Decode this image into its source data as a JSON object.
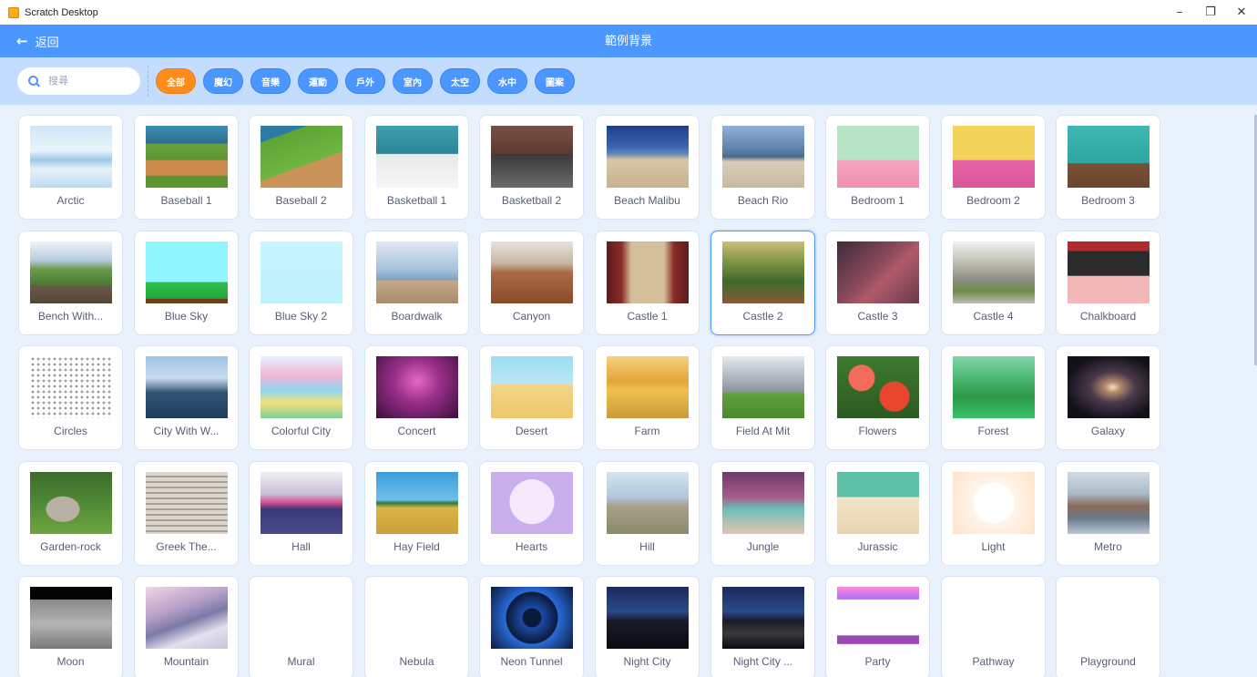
{
  "window": {
    "title": "Scratch Desktop",
    "controls": [
      "–",
      "❐",
      "✕"
    ]
  },
  "header": {
    "back_label": "返回",
    "title": "範例背景"
  },
  "search": {
    "placeholder": "搜尋"
  },
  "tags": [
    {
      "label": "全部",
      "active": true
    },
    {
      "label": "魔幻",
      "active": false
    },
    {
      "label": "音樂",
      "active": false
    },
    {
      "label": "運動",
      "active": false
    },
    {
      "label": "戶外",
      "active": false
    },
    {
      "label": "室內",
      "active": false
    },
    {
      "label": "太空",
      "active": false
    },
    {
      "label": "水中",
      "active": false
    },
    {
      "label": "圖案",
      "active": false
    }
  ],
  "backdrops": [
    "Arctic",
    "Baseball 1",
    "Baseball 2",
    "Basketball 1",
    "Basketball 2",
    "Beach Malibu",
    "Beach Rio",
    "Bedroom 1",
    "Bedroom 2",
    "Bedroom 3",
    "Bench With...",
    "Blue Sky",
    "Blue Sky 2",
    "Boardwalk",
    "Canyon",
    "Castle 1",
    "Castle 2",
    "Castle 3",
    "Castle 4",
    "Chalkboard",
    "Circles",
    "City With W...",
    "Colorful City",
    "Concert",
    "Desert",
    "Farm",
    "Field At Mit",
    "Flowers",
    "Forest",
    "Galaxy",
    "Garden-rock",
    "Greek The...",
    "Hall",
    "Hay Field",
    "Hearts",
    "Hill",
    "Jungle",
    "Jurassic",
    "Light",
    "Metro",
    "Moon",
    "Mountain",
    "Mural",
    "Nebula",
    "Neon Tunnel",
    "Night City",
    "Night City ...",
    "Party",
    "Pathway",
    "Playground"
  ],
  "selected_backdrop": "Castle 2",
  "colors": {
    "accent": "#4c97ff",
    "active_tag": "#ff8c1a",
    "filter_bar": "#c4dcfd",
    "label_text": "#575e75"
  }
}
